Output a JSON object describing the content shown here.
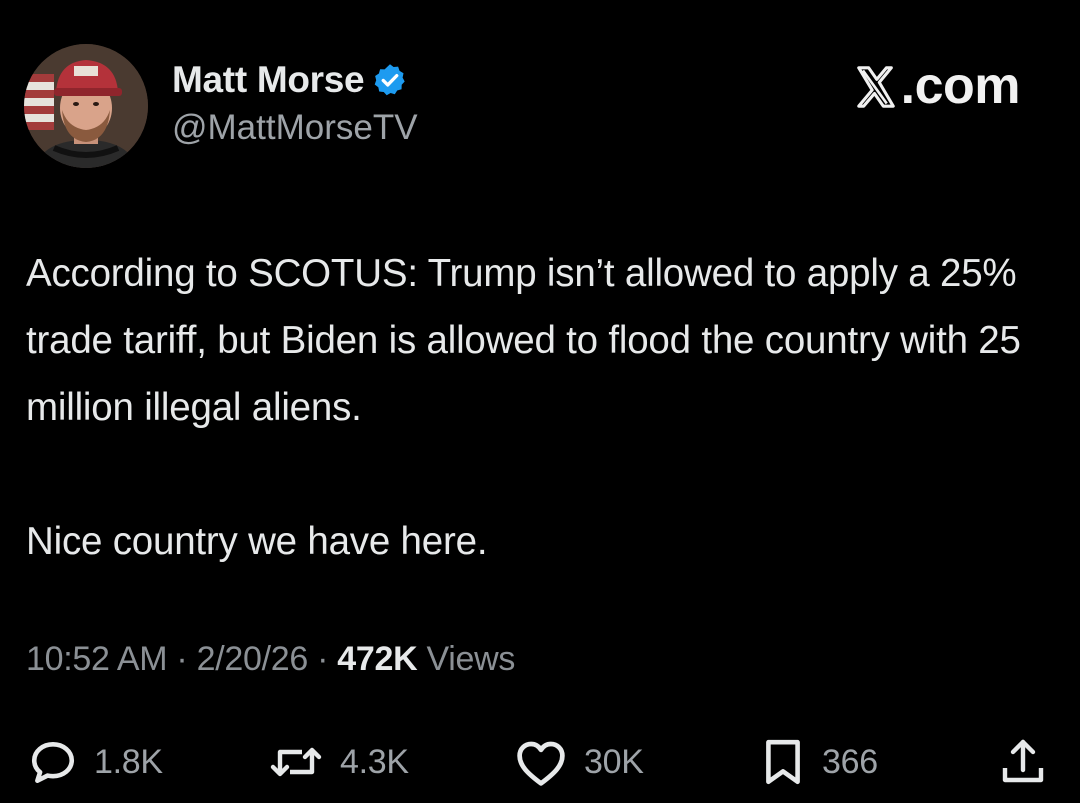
{
  "site": {
    "logo_text": ".com",
    "logo_icon": "x-logo-icon"
  },
  "author": {
    "display_name": "Matt Morse",
    "handle": "@MattMorseTV",
    "verified_icon": "verified-badge-icon",
    "verified_color": "#1d9bf0"
  },
  "tweet": {
    "paragraphs": [
      "According to SCOTUS: Trump isn’t allowed to apply a 25% trade tariff, but Biden is allowed to flood the country with 25 million illegal aliens.",
      "Nice country we have here."
    ]
  },
  "meta": {
    "time": "10:52 AM",
    "separator": " · ",
    "date": "2/20/26",
    "views_count": "472K",
    "views_label": " Views"
  },
  "actions": {
    "reply": {
      "icon": "reply-icon",
      "count": "1.8K"
    },
    "retweet": {
      "icon": "retweet-icon",
      "count": "4.3K"
    },
    "like": {
      "icon": "heart-icon",
      "count": "30K"
    },
    "bookmark": {
      "icon": "bookmark-icon",
      "count": "366"
    },
    "share": {
      "icon": "share-icon"
    }
  },
  "colors": {
    "background": "#000000",
    "text_primary": "#e7e9ea",
    "text_secondary": "#8b9095"
  }
}
